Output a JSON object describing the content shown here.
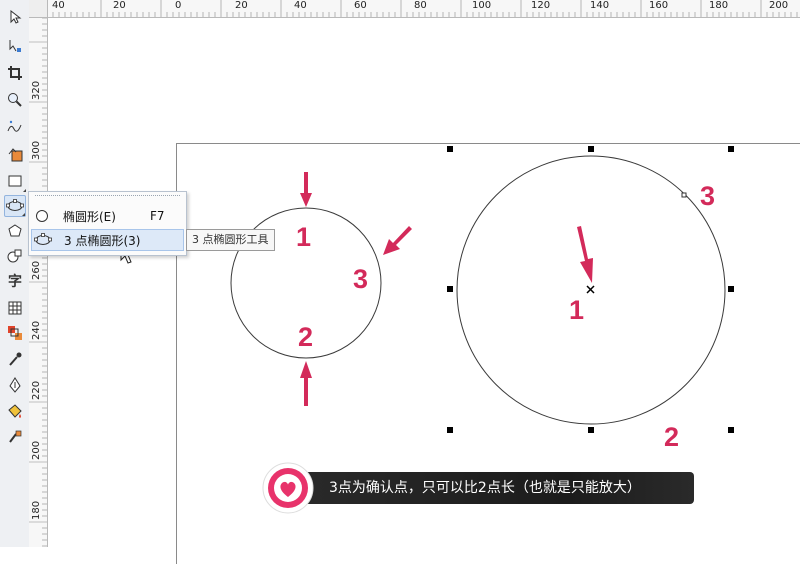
{
  "ruler_top": {
    "labels": [
      "40",
      "20",
      "0",
      "20",
      "40",
      "60",
      "80",
      "100",
      "120",
      "140",
      "160",
      "180",
      "200"
    ]
  },
  "ruler_left": {
    "labels": [
      "320",
      "300",
      "280",
      "260",
      "240",
      "220",
      "200",
      "180"
    ]
  },
  "toolbox": {
    "tools": [
      {
        "name": "pick-tool",
        "icon": "arrow-cursor-icon"
      },
      {
        "name": "shape-tool",
        "icon": "node-edit-icon"
      },
      {
        "name": "crop-tool",
        "icon": "crop-icon"
      },
      {
        "name": "zoom-tool",
        "icon": "magnifier-icon"
      },
      {
        "name": "freehand-tool",
        "icon": "freehand-icon"
      },
      {
        "name": "smart-fill-tool",
        "icon": "smart-fill-icon"
      },
      {
        "name": "rectangle-tool",
        "icon": "rectangle-icon"
      },
      {
        "name": "ellipse-tool",
        "icon": "three-point-ellipse-icon"
      },
      {
        "name": "polygon-tool",
        "icon": "polygon-icon"
      },
      {
        "name": "basic-shapes-tool",
        "icon": "basic-shapes-icon"
      },
      {
        "name": "text-tool",
        "icon": "text-icon",
        "glyph": "字"
      },
      {
        "name": "table-tool",
        "icon": "table-icon"
      },
      {
        "name": "blend-tool",
        "icon": "blend-icon"
      },
      {
        "name": "eyedropper-tool",
        "icon": "eyedropper-icon"
      },
      {
        "name": "outline-pen-tool",
        "icon": "pen-nib-icon"
      },
      {
        "name": "fill-tool",
        "icon": "paint-bucket-icon"
      },
      {
        "name": "interactive-fill-tool",
        "icon": "interactive-fill-icon"
      }
    ]
  },
  "flyout": {
    "items": [
      {
        "label": "椭圆形(E)",
        "shortcut": "F7",
        "icon": "ellipse-icon",
        "highlighted": false
      },
      {
        "label": "3 点椭圆形(3)",
        "shortcut": "",
        "icon": "three-point-ellipse-icon",
        "highlighted": true
      }
    ],
    "tooltip": "3 点椭圆形工具"
  },
  "annotations": {
    "left_circle_numbers": [
      "1",
      "3",
      "2"
    ],
    "right_circle_numbers": [
      "3",
      "1",
      "2"
    ],
    "accent_color": "#d32a5a"
  },
  "caption": {
    "text": "3点为确认点，只可以比2点长（也就是只能放大）",
    "badge_icon": "heart-icon",
    "badge_color": "#e8336b"
  }
}
